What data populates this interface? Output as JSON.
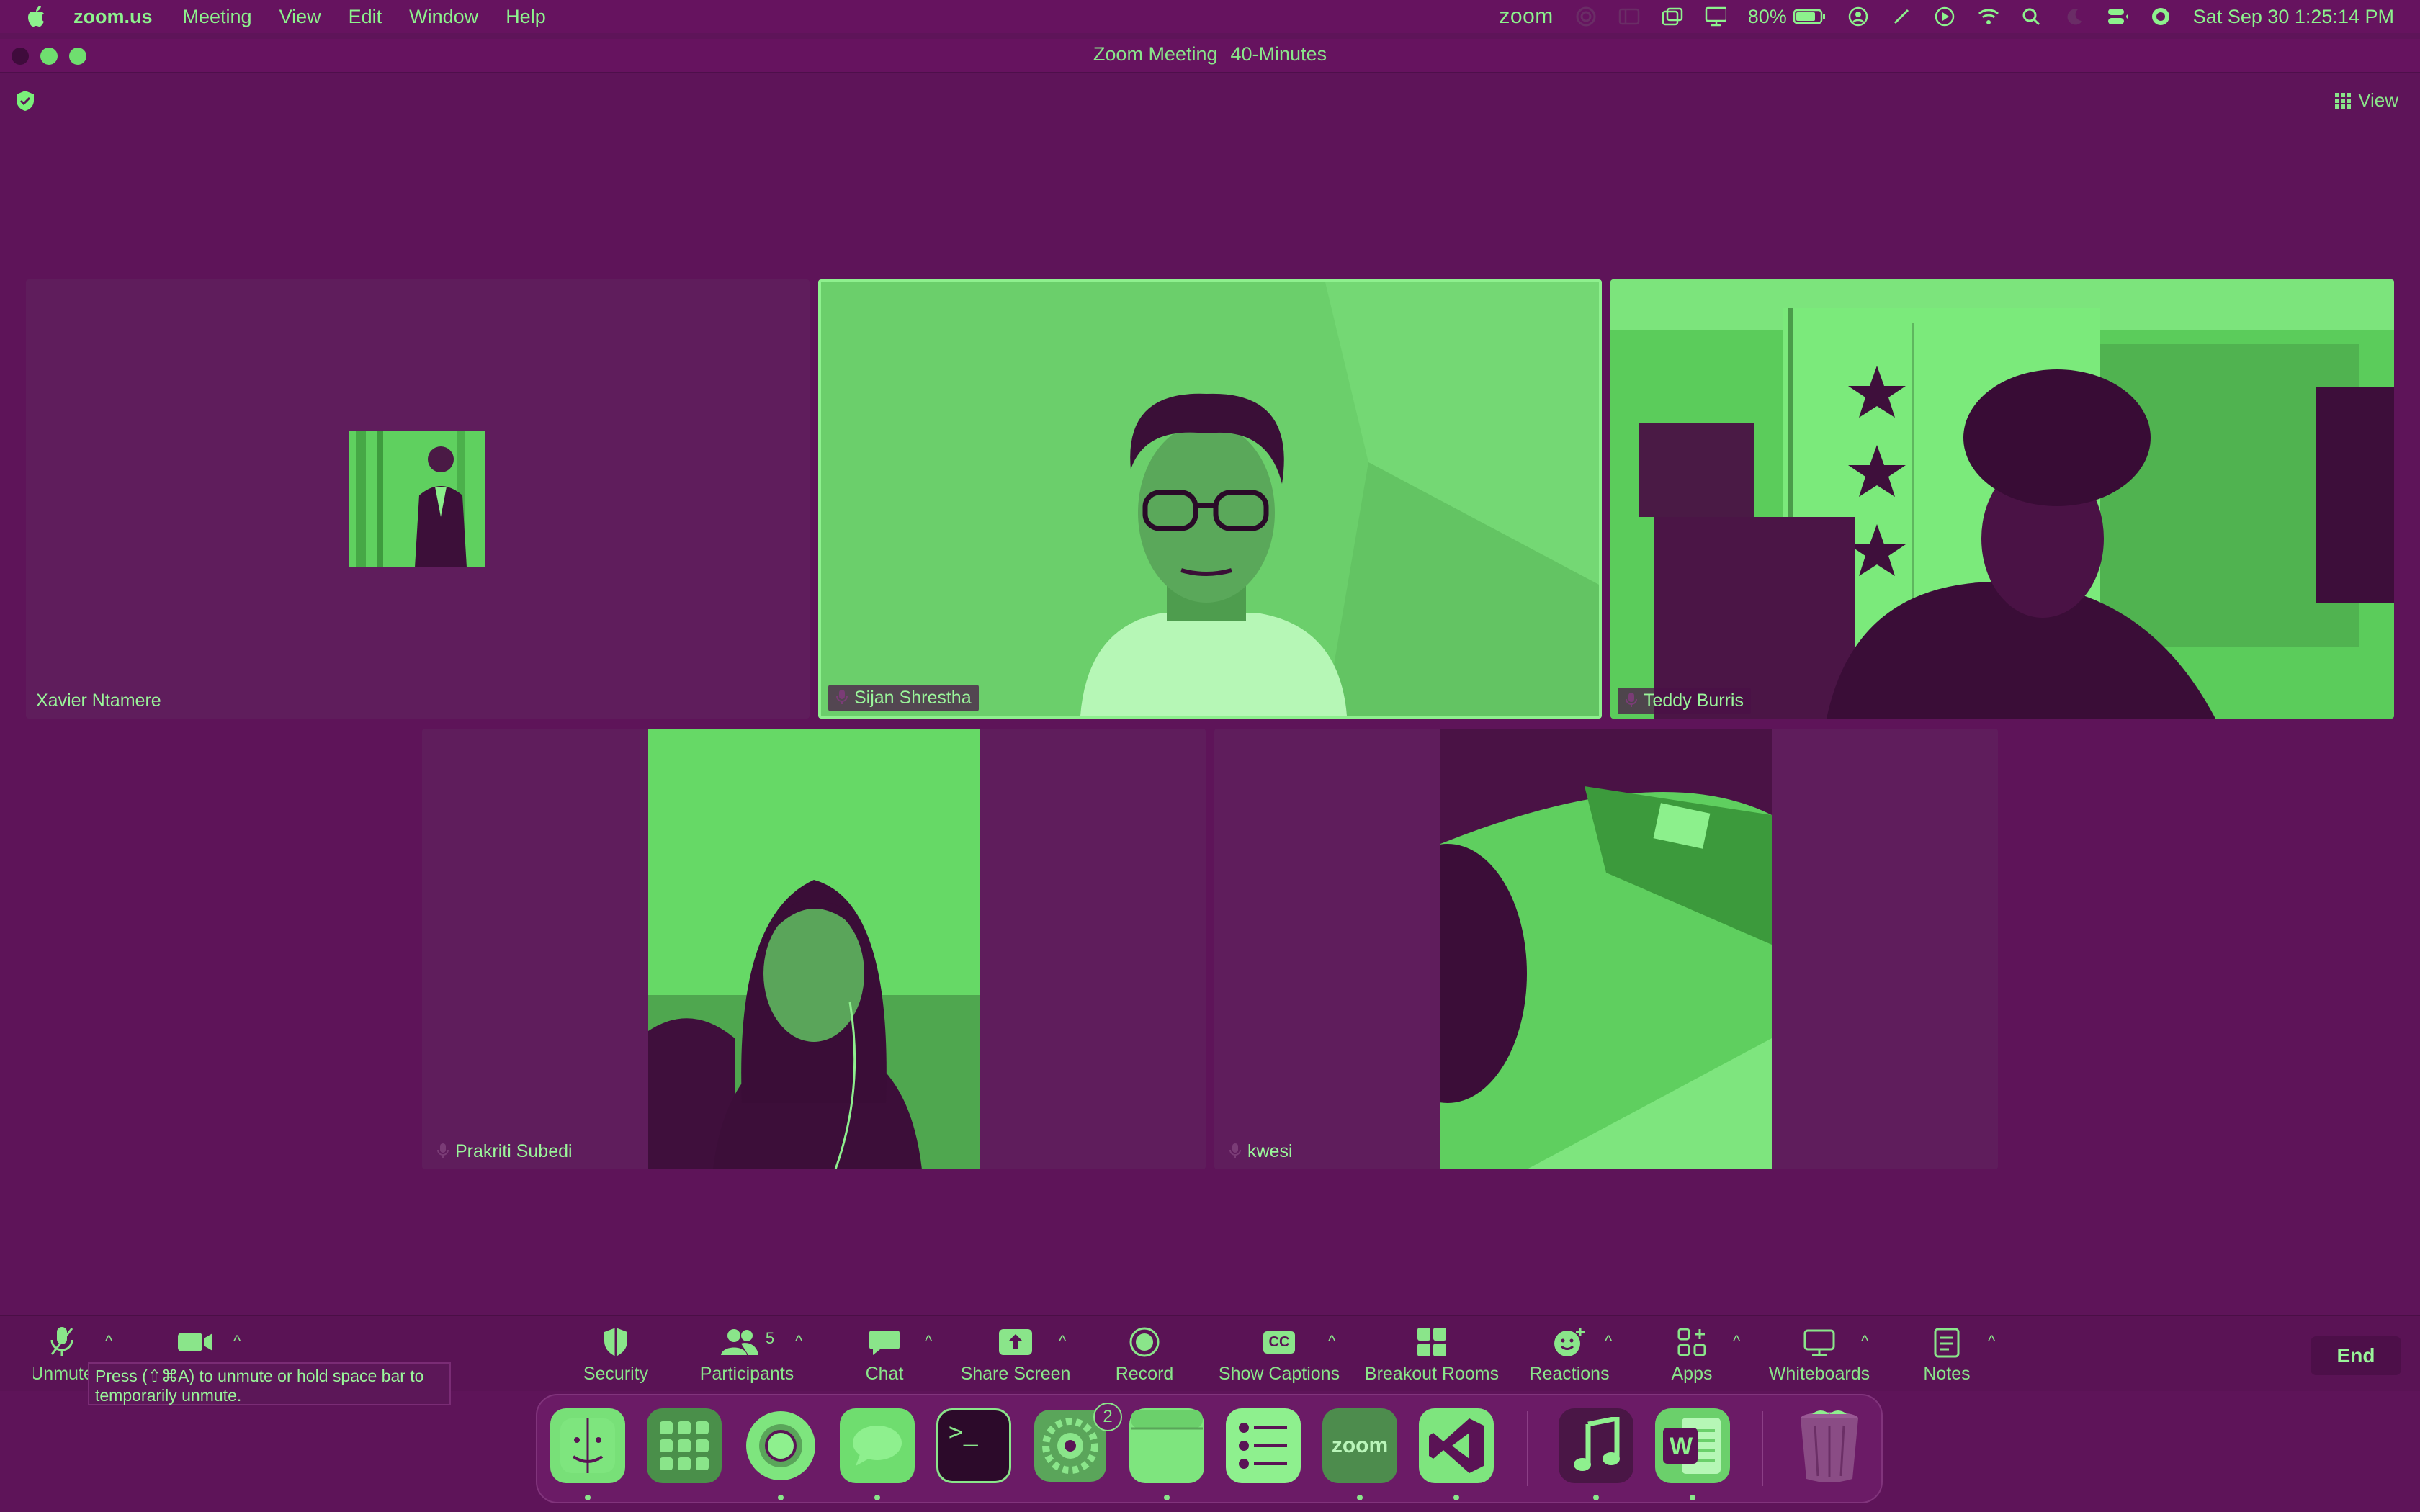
{
  "menubar": {
    "app_name": "zoom.us",
    "items": [
      "Meeting",
      "View",
      "Edit",
      "Window",
      "Help"
    ],
    "zoom_status": "zoom",
    "battery": "80%",
    "datetime": "Sat Sep 30  1:25:14 PM"
  },
  "window": {
    "title": "Zoom Meeting",
    "subtitle": "40-Minutes"
  },
  "meeting": {
    "view_label": "View",
    "participants": [
      {
        "name": "Xavier Ntamere"
      },
      {
        "name": "Sijan Shrestha"
      },
      {
        "name": "Teddy Burris"
      },
      {
        "name": "Prakriti Subedi"
      },
      {
        "name": "kwesi"
      }
    ]
  },
  "toolbar": {
    "unmute_label": "Unmute",
    "security_label": "Security",
    "participants_label": "Participants",
    "participants_count": "5",
    "chat_label": "Chat",
    "share_label": "Share Screen",
    "record_label": "Record",
    "captions_label": "Show Captions",
    "captions_icon_text": "CC",
    "breakout_label": "Breakout Rooms",
    "reactions_label": "Reactions",
    "apps_label": "Apps",
    "whiteboards_label": "Whiteboards",
    "notes_label": "Notes",
    "end_label": "End",
    "tooltip": "Press  (⇧⌘A) to unmute or hold space bar to temporarily unmute."
  },
  "dock": {
    "zoom_text": "zoom",
    "settings_badge": "2",
    "terminal_text": ">_",
    "word_text": "W"
  },
  "colors": {
    "background": "#5e1459",
    "accent": "#7af07a",
    "tile": "#5f1d5c"
  }
}
